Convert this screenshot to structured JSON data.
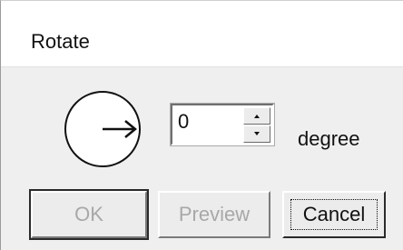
{
  "dialog": {
    "title": "Rotate"
  },
  "rotation": {
    "value": "0",
    "unit": "degree",
    "dial_icon": "arrow-right-icon"
  },
  "buttons": {
    "ok_label": "OK",
    "preview_label": "Preview",
    "cancel_label": "Cancel"
  },
  "colors": {
    "dialog_bg": "#efefef",
    "disabled_text": "#a8a8a8"
  }
}
